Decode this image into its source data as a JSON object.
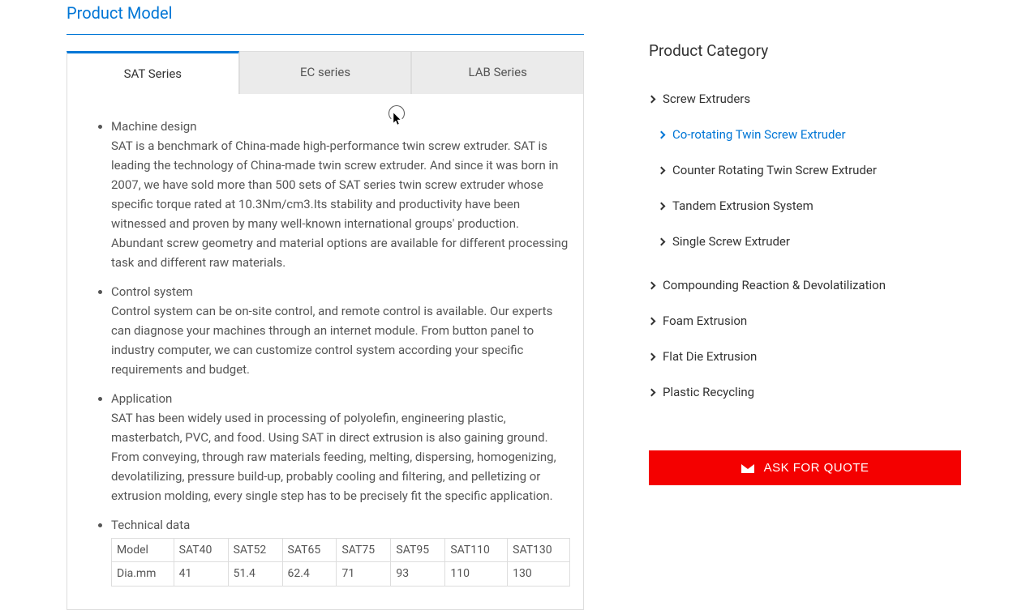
{
  "main": {
    "section_title": "Product Model",
    "tabs": [
      {
        "label": "SAT Series"
      },
      {
        "label": "EC series"
      },
      {
        "label": "LAB Series"
      }
    ],
    "bullets": [
      {
        "heading": "Machine design",
        "body": "SAT is a benchmark of China-made high-performance twin screw extruder. SAT is leading the technology of China-made twin screw extruder. And since it was born in 2007, we have sold more than 500 sets of SAT series twin screw extruder whose specific torque rated at 10.3Nm/cm3.Its stability and productivity have been witnessed and proven by many well-known international groups' production. Abundant screw geometry and material options are available for different processing task and different raw materials."
      },
      {
        "heading": "Control system",
        "body": "Control system can be on-site control, and remote control is available. Our experts can diagnose your machines through an internet module. From button panel to industry computer, we can customize control system according your specific requirements and budget."
      },
      {
        "heading": "Application",
        "body": "SAT has been widely used in processing of polyolefin, engineering plastic, masterbatch, PVC, and food. Using SAT in direct extrusion is also gaining ground. From conveying, through raw materials feeding, melting, dispersing, homogenizing, devolatilizing, pressure build-up, probably cooling and filtering, and pelletizing or extrusion molding, every single step has to be precisely fit the specific application."
      },
      {
        "heading": "Technical data",
        "body": ""
      }
    ],
    "table": {
      "rows": [
        [
          "Model",
          "SAT40",
          "SAT52",
          "SAT65",
          "SAT75",
          "SAT95",
          "SAT110",
          "SAT130"
        ],
        [
          "Dia.mm",
          "41",
          "51.4",
          "62.4",
          "71",
          "93",
          "110",
          "130"
        ]
      ]
    }
  },
  "sidebar": {
    "title": "Product Category",
    "categories": [
      {
        "label": "Screw Extruders",
        "sub": false,
        "active": false
      },
      {
        "label": "Co-rotating Twin Screw Extruder",
        "sub": true,
        "active": true
      },
      {
        "label": "Counter Rotating Twin Screw Extruder",
        "sub": true,
        "active": false
      },
      {
        "label": "Tandem Extrusion System",
        "sub": true,
        "active": false
      },
      {
        "label": "Single Screw Extruder",
        "sub": true,
        "active": false
      },
      {
        "label": "Compounding Reaction & Devolatilization",
        "sub": false,
        "active": false
      },
      {
        "label": "Foam Extrusion",
        "sub": false,
        "active": false
      },
      {
        "label": "Flat Die Extrusion",
        "sub": false,
        "active": false
      },
      {
        "label": "Plastic Recycling",
        "sub": false,
        "active": false
      }
    ],
    "cta_label": "ASK FOR QUOTE"
  }
}
